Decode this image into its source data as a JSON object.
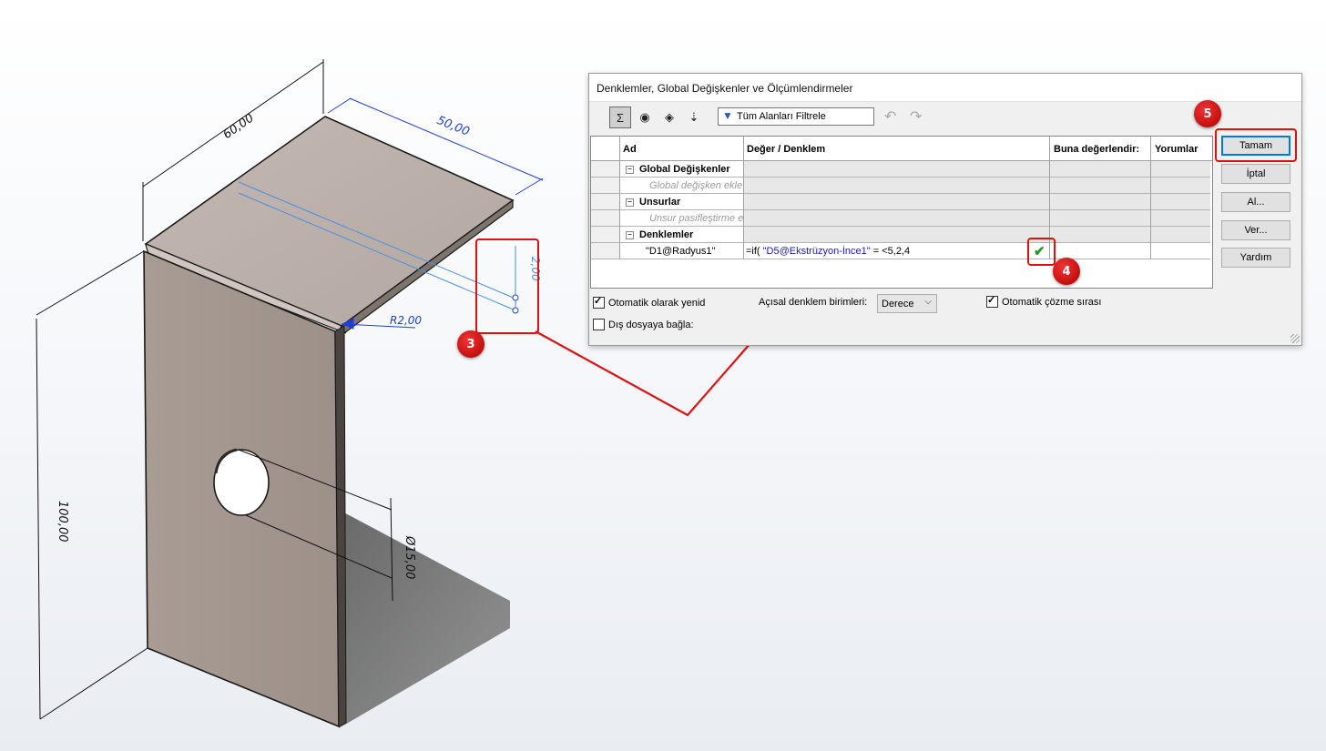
{
  "dialog": {
    "title": "Denklemler, Global Değişkenler ve Ölçümlendirmeler",
    "filter_placeholder": "Tüm Alanları Filtrele",
    "columns": [
      "Ad",
      "Değer / Denklem",
      "Buna değerlendir:",
      "Yorumlar"
    ],
    "groups": {
      "global": "Global Değişkenler",
      "global_hint": "Global değişken ekle",
      "features": "Unsurlar",
      "features_hint": "Unsur pasifleştirme ek",
      "equations": "Denklemler"
    },
    "equation": {
      "name": "\"D1@Radyus1\"",
      "prefix": "=if( ",
      "ref": "\"D5@Ekstrüzyon-İnce1\"",
      "suffix": " = <5,2,4"
    },
    "buttons": [
      "Tamam",
      "İptal",
      "Al...",
      "Ver...",
      "Yardım"
    ],
    "options": {
      "auto_rebuild": "Otomatik olarak yenid",
      "angular_units_label": "Açısal denklem birimleri:",
      "angular_units_value": "Derece",
      "auto_solve": "Otomatik çözme sırası",
      "link_external": "Dış dosyaya bağla:"
    }
  },
  "model": {
    "dimensions": [
      "60,00",
      "50,00",
      "2,00",
      "R2,00",
      "100,00",
      "Ø15,00"
    ]
  },
  "annotations": [
    "3",
    "4",
    "5"
  ],
  "colors": {
    "accent": "#0078d7",
    "annotation_red": "#e01010",
    "dimension_blue": "#1f3fd6",
    "part_face": "#ab9f98"
  }
}
